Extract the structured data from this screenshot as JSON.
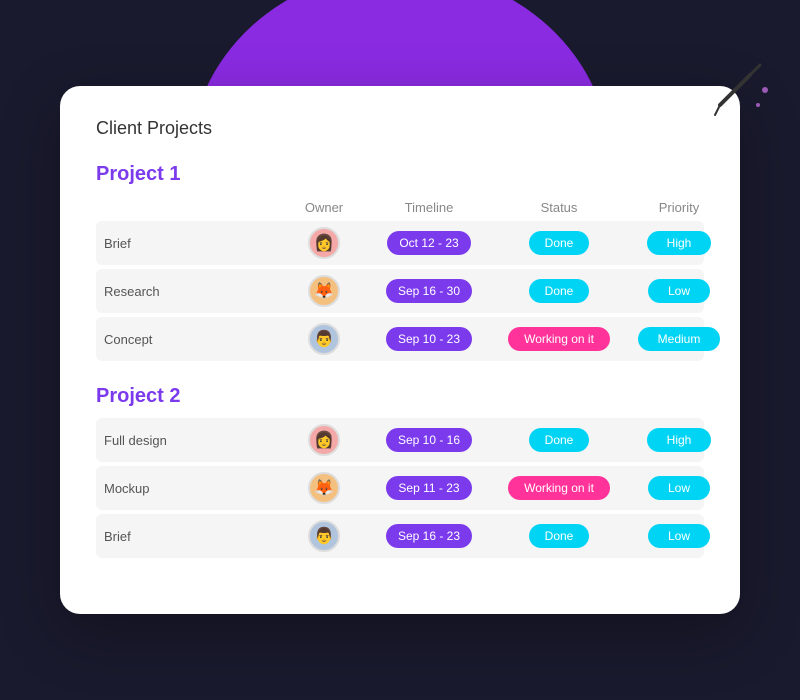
{
  "page": {
    "title": "Client Projects",
    "bg_color": "#8a2be2"
  },
  "projects": [
    {
      "id": "project1",
      "title": "Project 1",
      "headers": [
        "",
        "Owner",
        "Timeline",
        "Status",
        "Priority"
      ],
      "tasks": [
        {
          "name": "Brief",
          "owner_emoji": "👩",
          "owner_color": "#f4a9a8",
          "timeline": "Oct 12 - 23",
          "status": "Done",
          "status_type": "done",
          "priority": "High",
          "priority_type": "high"
        },
        {
          "name": "Research",
          "owner_emoji": "🦊",
          "owner_color": "#f4c080",
          "timeline": "Sep 16 - 30",
          "status": "Done",
          "status_type": "done",
          "priority": "Low",
          "priority_type": "low"
        },
        {
          "name": "Concept",
          "owner_emoji": "👨",
          "owner_color": "#b0c4de",
          "timeline": "Sep 10 - 23",
          "status": "Working on it",
          "status_type": "working",
          "priority": "Medium",
          "priority_type": "medium"
        }
      ]
    },
    {
      "id": "project2",
      "title": "Project 2",
      "tasks": [
        {
          "name": "Full design",
          "owner_emoji": "👩",
          "owner_color": "#f4a9a8",
          "timeline": "Sep 10 - 16",
          "status": "Done",
          "status_type": "done",
          "priority": "High",
          "priority_type": "high"
        },
        {
          "name": "Mockup",
          "owner_emoji": "🦊",
          "owner_color": "#f4c080",
          "timeline": "Sep 11 - 23",
          "status": "Working on it",
          "status_type": "working",
          "priority": "Low",
          "priority_type": "low"
        },
        {
          "name": "Brief",
          "owner_emoji": "👨",
          "owner_color": "#b0c4de",
          "timeline": "Sep 16 - 23",
          "status": "Done",
          "status_type": "done",
          "priority": "Low",
          "priority_type": "low"
        }
      ]
    }
  ]
}
